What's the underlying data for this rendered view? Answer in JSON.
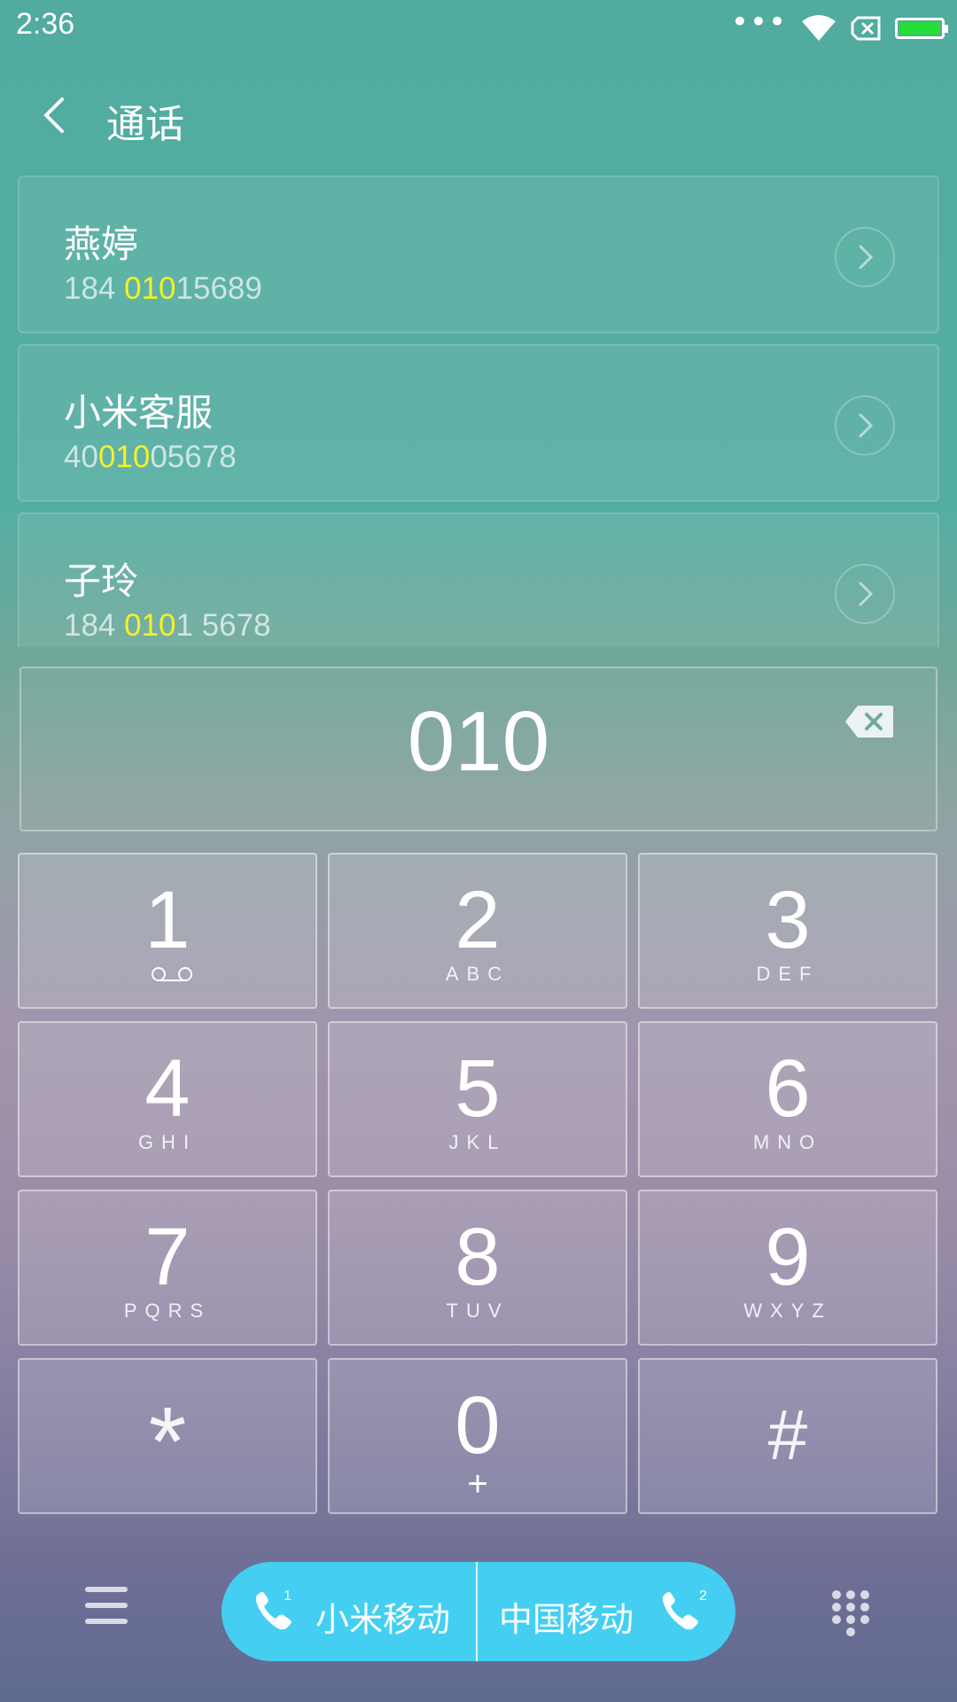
{
  "status_bar": {
    "time": "2:36",
    "dots": "•••",
    "icons": [
      "wifi-icon",
      "no-sim-icon",
      "battery-icon"
    ],
    "battery_color": "#22e036"
  },
  "header": {
    "back_icon": "chevron-left-icon",
    "title": "通话"
  },
  "contacts": [
    {
      "name": "燕婷",
      "number_prefix": "184 ",
      "number_match": "010",
      "number_suffix": "15689"
    },
    {
      "name": "小米客服",
      "number_prefix": "40",
      "number_match": "010",
      "number_suffix": "05678"
    },
    {
      "name": "子玲",
      "number_prefix": "184 ",
      "number_match": "010",
      "number_suffix": "1 5678"
    }
  ],
  "highlight_color": "#f3f12a",
  "display": {
    "number": "010",
    "delete_icon": "backspace-icon"
  },
  "keypad": {
    "keys": [
      {
        "digit": "1",
        "letters": "",
        "sub_icon": "voicemail-icon"
      },
      {
        "digit": "2",
        "letters": "ABC"
      },
      {
        "digit": "3",
        "letters": "DEF"
      },
      {
        "digit": "4",
        "letters": "GHI"
      },
      {
        "digit": "5",
        "letters": "JKL"
      },
      {
        "digit": "6",
        "letters": "MNO"
      },
      {
        "digit": "7",
        "letters": "PQRS"
      },
      {
        "digit": "8",
        "letters": "TUV"
      },
      {
        "digit": "9",
        "letters": "WXYZ"
      },
      {
        "digit": "*",
        "letters": ""
      },
      {
        "digit": "0",
        "letters": "+"
      },
      {
        "digit": "#",
        "letters": ""
      }
    ]
  },
  "bottom_bar": {
    "menu_icon": "hamburger-menu-icon",
    "call_sim1": {
      "label": "小米移动",
      "sim": "1",
      "icon": "phone-icon"
    },
    "call_sim2": {
      "label": "中国移动",
      "sim": "2",
      "icon": "phone-icon"
    },
    "call_color": "#44cff2",
    "keypad_toggle_icon": "dialpad-icon"
  }
}
